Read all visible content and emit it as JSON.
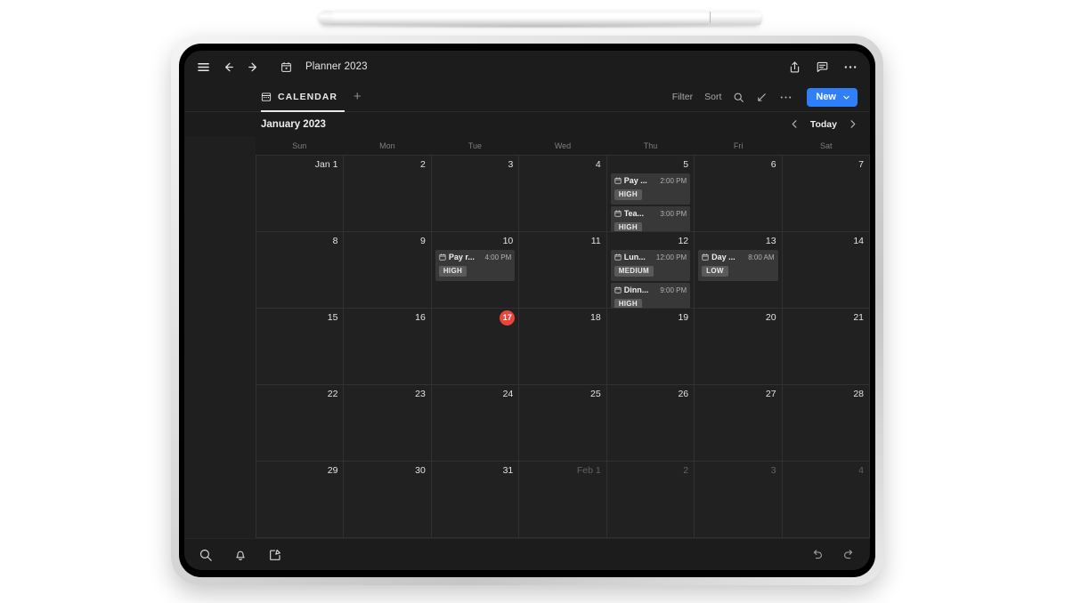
{
  "device": {
    "type": "tablet",
    "stylus": "stylus"
  },
  "appbar": {
    "menu_icon": "hamburger-menu-icon",
    "back_icon": "arrow-left-icon",
    "forward_icon": "arrow-right-icon",
    "doc_icon": "calendar-icon",
    "title": "Planner 2023",
    "share_icon": "share-icon",
    "comment_icon": "comment-icon",
    "more_icon": "ellipsis-icon"
  },
  "tabbar": {
    "tab_icon": "calendar-grid-icon",
    "tab_label": "CALENDAR",
    "add_tab_label": "+",
    "filter_label": "Filter",
    "sort_label": "Sort",
    "search_icon": "search-icon",
    "collapse_icon": "collapse-arrow-icon",
    "more_icon": "ellipsis-icon",
    "new_label": "New",
    "new_chevron": "chevron-down-icon"
  },
  "monthbar": {
    "title": "January 2023",
    "prev_icon": "chevron-left-icon",
    "today_label": "Today",
    "next_icon": "chevron-right-icon"
  },
  "calendar": {
    "weekdays": [
      "Sun",
      "Mon",
      "Tue",
      "Wed",
      "Thu",
      "Fri",
      "Sat"
    ],
    "today_date": 17,
    "accent_today": "#e8453c",
    "accent_new": "#2e7ff8",
    "weeks": [
      [
        {
          "label": "Jan 1",
          "muted": false,
          "events": []
        },
        {
          "label": "2",
          "muted": false,
          "events": []
        },
        {
          "label": "3",
          "muted": false,
          "events": []
        },
        {
          "label": "4",
          "muted": false,
          "events": []
        },
        {
          "label": "5",
          "muted": false,
          "events": [
            {
              "icon": "event-calendar-icon",
              "name": "Pay ...",
              "time": "2:00 PM",
              "priority": "HIGH"
            },
            {
              "icon": "event-calendar-icon",
              "name": "Tea...",
              "time": "3:00 PM",
              "priority": "HIGH"
            }
          ]
        },
        {
          "label": "6",
          "muted": false,
          "events": []
        },
        {
          "label": "7",
          "muted": false,
          "events": []
        }
      ],
      [
        {
          "label": "8",
          "muted": false,
          "events": []
        },
        {
          "label": "9",
          "muted": false,
          "events": []
        },
        {
          "label": "10",
          "muted": false,
          "events": [
            {
              "icon": "event-calendar-icon",
              "name": "Pay r...",
              "time": "4:00 PM",
              "priority": "HIGH"
            }
          ]
        },
        {
          "label": "11",
          "muted": false,
          "events": []
        },
        {
          "label": "12",
          "muted": false,
          "events": [
            {
              "icon": "event-calendar-icon",
              "name": "Lun...",
              "time": "12:00 PM",
              "priority": "MEDIUM"
            },
            {
              "icon": "event-calendar-icon",
              "name": "Dinn...",
              "time": "9:00 PM",
              "priority": "HIGH"
            }
          ]
        },
        {
          "label": "13",
          "muted": false,
          "events": [
            {
              "icon": "event-calendar-icon",
              "name": "Day ...",
              "time": "8:00 AM",
              "priority": "LOW"
            }
          ]
        },
        {
          "label": "14",
          "muted": false,
          "events": []
        }
      ],
      [
        {
          "label": "15",
          "muted": false,
          "events": []
        },
        {
          "label": "16",
          "muted": false,
          "events": []
        },
        {
          "label": "17",
          "muted": false,
          "today": true,
          "events": []
        },
        {
          "label": "18",
          "muted": false,
          "events": []
        },
        {
          "label": "19",
          "muted": false,
          "events": []
        },
        {
          "label": "20",
          "muted": false,
          "events": []
        },
        {
          "label": "21",
          "muted": false,
          "events": []
        }
      ],
      [
        {
          "label": "22",
          "muted": false,
          "events": []
        },
        {
          "label": "23",
          "muted": false,
          "events": []
        },
        {
          "label": "24",
          "muted": false,
          "events": []
        },
        {
          "label": "25",
          "muted": false,
          "events": []
        },
        {
          "label": "26",
          "muted": false,
          "events": []
        },
        {
          "label": "27",
          "muted": false,
          "events": []
        },
        {
          "label": "28",
          "muted": false,
          "events": []
        }
      ],
      [
        {
          "label": "29",
          "muted": false,
          "events": []
        },
        {
          "label": "30",
          "muted": false,
          "events": []
        },
        {
          "label": "31",
          "muted": false,
          "events": []
        },
        {
          "label": "Feb 1",
          "muted": true,
          "events": []
        },
        {
          "label": "2",
          "muted": true,
          "events": []
        },
        {
          "label": "3",
          "muted": true,
          "events": []
        },
        {
          "label": "4",
          "muted": true,
          "events": []
        }
      ]
    ]
  },
  "bottombar": {
    "search_icon": "search-icon",
    "bell_icon": "notification-bell-icon",
    "compose_icon": "compose-icon",
    "undo_icon": "undo-icon",
    "redo_icon": "redo-icon"
  }
}
